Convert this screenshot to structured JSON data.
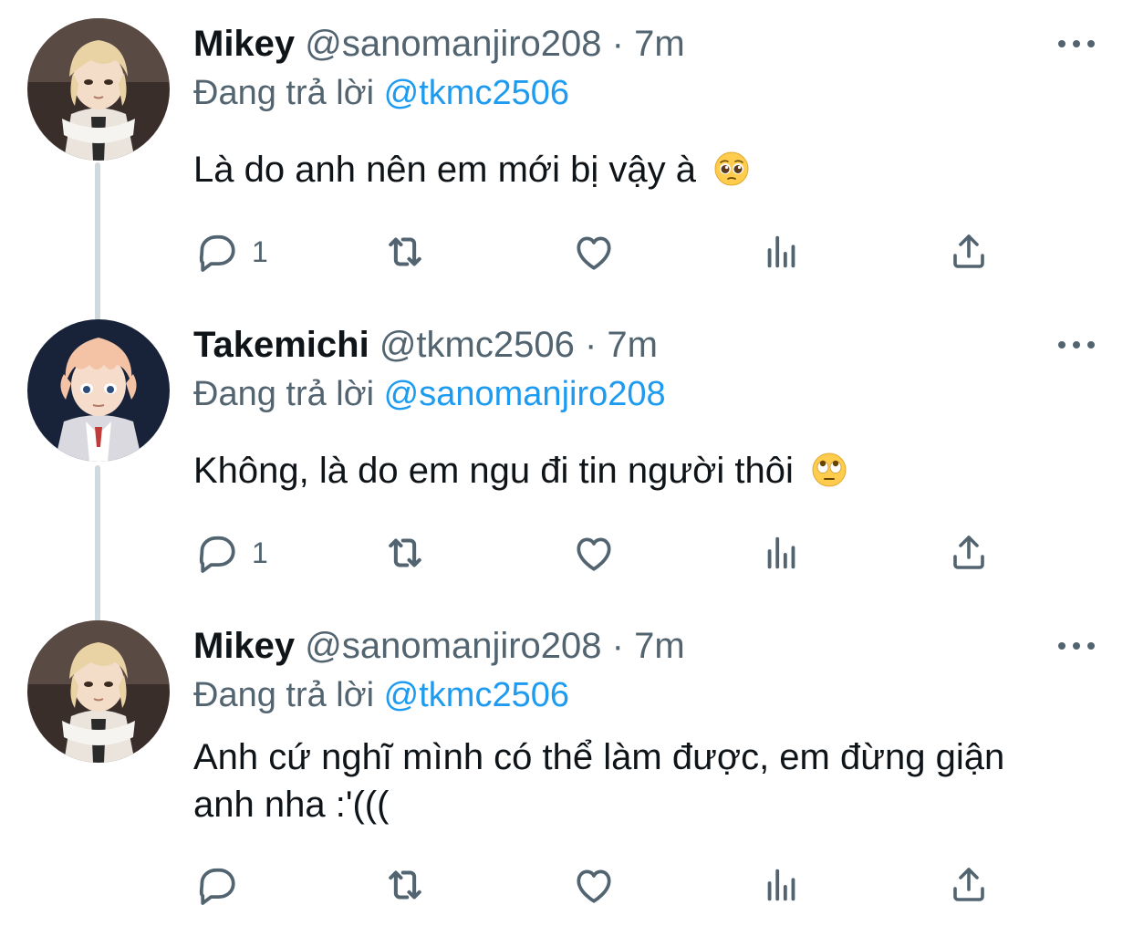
{
  "tweets": [
    {
      "name": "Mikey",
      "handle": "@sanomanjiro208",
      "separator": "·",
      "time": "7m",
      "replying_prefix": "Đang trả lời",
      "replying_to": "@tkmc2506",
      "text": "Là do anh nên em mới bị vậy à",
      "emoji": "pleading-face-emoji",
      "reply_count": "1",
      "avatar": "mikey-avatar"
    },
    {
      "name": "Takemichi",
      "handle": "@tkmc2506",
      "separator": "·",
      "time": "7m",
      "replying_prefix": "Đang trả lời",
      "replying_to": "@sanomanjiro208",
      "text": "Không, là do em ngu đi tin người thôi",
      "emoji": "eye-roll-emoji",
      "reply_count": "1",
      "avatar": "takemichi-avatar"
    },
    {
      "name": "Mikey",
      "handle": "@sanomanjiro208",
      "separator": "·",
      "time": "7m",
      "replying_prefix": "Đang trả lời",
      "replying_to": "@tkmc2506",
      "text_line1": "Anh cứ nghĩ mình có thể làm được, em đừng giận",
      "text_line2": "anh nha :'(((",
      "reply_count": "",
      "avatar": "mikey-avatar"
    }
  ],
  "icons": {
    "reply": "reply-icon",
    "retweet": "retweet-icon",
    "like": "heart-icon",
    "analytics": "analytics-icon",
    "share": "share-icon",
    "more": "more-icon"
  },
  "colors": {
    "text": "#0f1419",
    "secondary": "#536471",
    "accent": "#1d9bf0",
    "thread_line": "#cfd9de"
  }
}
